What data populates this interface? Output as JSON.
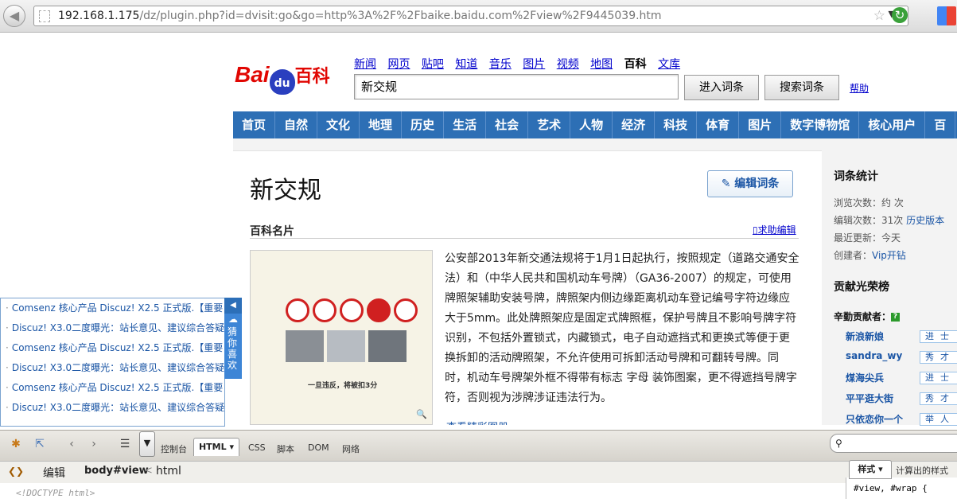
{
  "browser": {
    "url_host": "192.168.1.175",
    "url_path": "/dz/plugin.php?id=dvisit:go&go=http%3A%2F%2Fbaike.baidu.com%2Fview%2F9445039.htm"
  },
  "header": {
    "logo_bai": "Bai",
    "logo_du": "du",
    "logo_baike": "百科",
    "nav": [
      "新闻",
      "网页",
      "贴吧",
      "知道",
      "音乐",
      "图片",
      "视频",
      "地图",
      "百科",
      "文库"
    ],
    "current_nav": "百科",
    "search_value": "新交规",
    "enter_button": "进入词条",
    "search_button": "搜索词条",
    "help_link": "帮助"
  },
  "category_nav": [
    "首页",
    "自然",
    "文化",
    "地理",
    "历史",
    "生活",
    "社会",
    "艺术",
    "人物",
    "经济",
    "科技",
    "体育",
    "图片",
    "数字博物馆",
    "核心用户",
    "百"
  ],
  "article": {
    "title": "新交规",
    "edit_button": "编辑词条",
    "pic_heading": "百科名片",
    "help_edit": "求助编辑",
    "photo_caption": "一旦违反，将被扣3分",
    "body": "公安部2013年新交通法规将于1月1日起执行，按照规定（道路交通安全法）和（中华人民共和国机动车号牌）（GA36-2007）的规定，可使用牌照架辅助安装号牌，牌照架内侧边缘距离机动车登记编号字符边缘应大于5mm。此处牌照架应是固定式牌照框，保护号牌且不影响号牌字符识别，不包括外置锁式，内藏锁式，电子自动遮挡式和更换式等便于更换拆卸的活动牌照架，不允许使用可拆卸活动号牌和可翻转号牌。同时，机动车号牌架外框不得带有标志 字母 装饰图案，更不得遮挡号牌字符，否则视为涉牌涉证违法行为。",
    "more_pics": "查看精彩图册"
  },
  "sidebar": {
    "stats_heading": "词条统计",
    "views": "浏览次数：约 次",
    "edits": "编辑次数：31次",
    "history_link": "历史版本",
    "last_update": "最近更新：今天",
    "creator_label": "创建者：",
    "creator": "Vip开钻",
    "honor_heading": "贡献光荣榜",
    "hardworking_label": "辛勤贡献者：",
    "contributors": [
      {
        "name": "新浪新娘",
        "badge": "进士"
      },
      {
        "name": "sandra_wy",
        "badge": "秀才"
      },
      {
        "name": "煤海尖兵",
        "badge": "进士"
      },
      {
        "name": "平平逛大街",
        "badge": "秀才"
      },
      {
        "name": "只依恋你一个",
        "badge": "举人"
      }
    ]
  },
  "widget": {
    "items": [
      "Comsenz 核心产品 Discuz! X2.5 正式版.【重要",
      "Discuz! X3.0二度曝光：站长意见、建议综合答疑",
      "Comsenz 核心产品 Discuz! X2.5 正式版.【重要",
      "Discuz! X3.0二度曝光：站长意见、建议综合答疑",
      "Comsenz 核心产品 Discuz! X2.5 正式版.【重要",
      "Discuz! X3.0二度曝光：站长意见、建议综合答疑"
    ],
    "tab_label": "猜你喜欢"
  },
  "firebug": {
    "tabs": [
      "控制台",
      "HTML",
      "CSS",
      "脚本",
      "DOM",
      "网络"
    ],
    "active_tab": "HTML",
    "edit_label": "编辑",
    "crumb1": "body#view",
    "crumb2": "html",
    "doctype": "<!DOCTYPE html>",
    "style_tab": "样式",
    "computed_tab": "计算出的样式",
    "css_rule": "#view, #wrap {"
  }
}
